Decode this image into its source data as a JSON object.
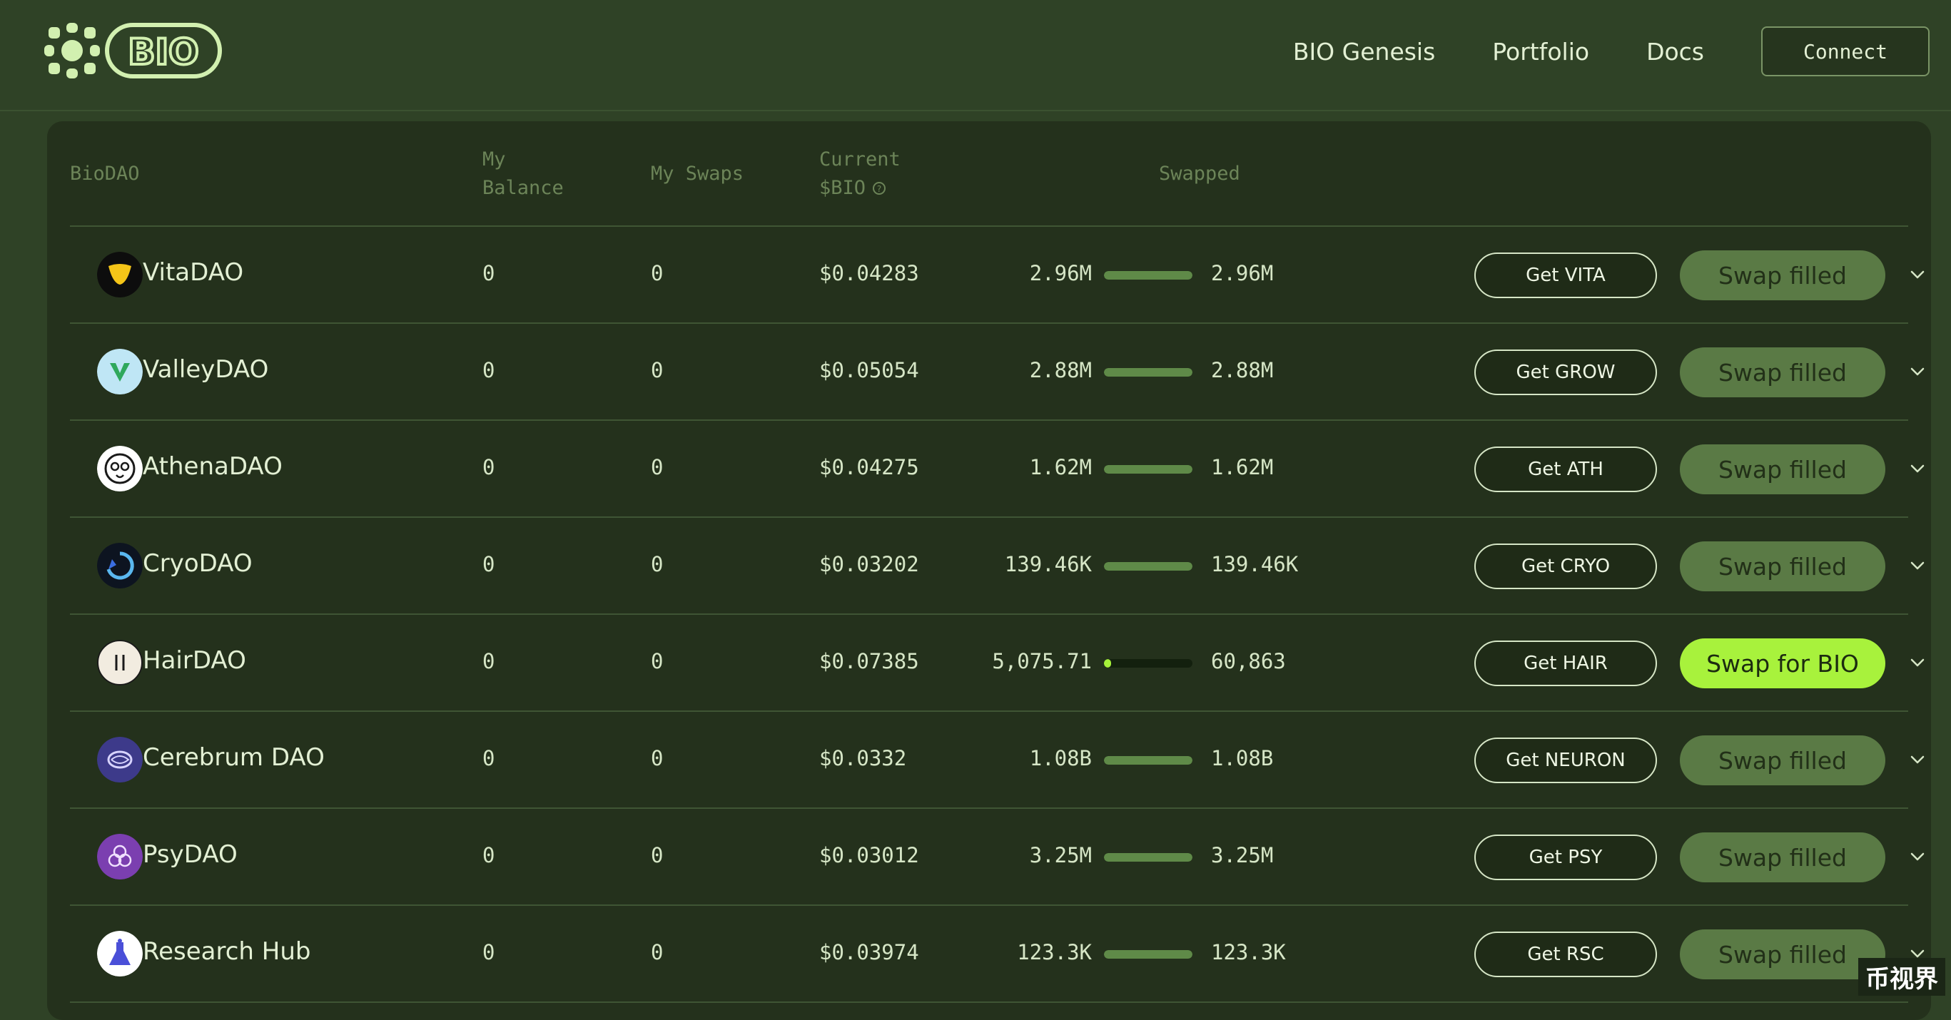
{
  "header": {
    "logo_text": "BIO",
    "nav": [
      "BIO Genesis",
      "Portfolio",
      "Docs"
    ],
    "connect_label": "Connect"
  },
  "table": {
    "columns": {
      "biodao": "BioDAO",
      "balance_line1": "My",
      "balance_line2": "Balance",
      "swaps": "My Swaps",
      "price_line1": "Current",
      "price_line2": "$BIO",
      "swapped": "Swapped"
    },
    "rows": [
      {
        "name": "VitaDAO",
        "icon": "vitadao-logo-icon",
        "balance": "0",
        "swaps": "0",
        "price": "$0.04283",
        "filled": "2.96M",
        "target": "2.96M",
        "progress": 1.0,
        "get": "Get VITA",
        "swap": "Swap filled",
        "active": false
      },
      {
        "name": "ValleyDAO",
        "icon": "valleydao-logo-icon",
        "balance": "0",
        "swaps": "0",
        "price": "$0.05054",
        "filled": "2.88M",
        "target": "2.88M",
        "progress": 1.0,
        "get": "Get GROW",
        "swap": "Swap filled",
        "active": false
      },
      {
        "name": "AthenaDAO",
        "icon": "athenadao-logo-icon",
        "balance": "0",
        "swaps": "0",
        "price": "$0.04275",
        "filled": "1.62M",
        "target": "1.62M",
        "progress": 1.0,
        "get": "Get ATH",
        "swap": "Swap filled",
        "active": false
      },
      {
        "name": "CryoDAO",
        "icon": "cryodao-logo-icon",
        "balance": "0",
        "swaps": "0",
        "price": "$0.03202",
        "filled": "139.46K",
        "target": "139.46K",
        "progress": 1.0,
        "get": "Get CRYO",
        "swap": "Swap filled",
        "active": false
      },
      {
        "name": "HairDAO",
        "icon": "hairdao-logo-icon",
        "balance": "0",
        "swaps": "0",
        "price": "$0.07385",
        "filled": "5,075.71",
        "target": "60,863",
        "progress": 0.083,
        "get": "Get HAIR",
        "swap": "Swap for BIO",
        "active": true
      },
      {
        "name": "Cerebrum DAO",
        "icon": "cerebrumdao-logo-icon",
        "balance": "0",
        "swaps": "0",
        "price": "$0.0332",
        "filled": "1.08B",
        "target": "1.08B",
        "progress": 1.0,
        "get": "Get NEURON",
        "swap": "Swap filled",
        "active": false
      },
      {
        "name": "PsyDAO",
        "icon": "psydao-logo-icon",
        "balance": "0",
        "swaps": "0",
        "price": "$0.03012",
        "filled": "3.25M",
        "target": "3.25M",
        "progress": 1.0,
        "get": "Get PSY",
        "swap": "Swap filled",
        "active": false
      },
      {
        "name": "Research Hub",
        "icon": "researchhub-logo-icon",
        "balance": "0",
        "swaps": "0",
        "price": "$0.03974",
        "filled": "123.3K",
        "target": "123.3K",
        "progress": 1.0,
        "get": "Get RSC",
        "swap": "Swap filled",
        "active": false
      }
    ]
  },
  "watermark": "币视界",
  "colors": {
    "background": "#2f4226",
    "panel": "#24311c",
    "accent_lime": "#a8f23c",
    "filled_button": "#5a7a45"
  }
}
